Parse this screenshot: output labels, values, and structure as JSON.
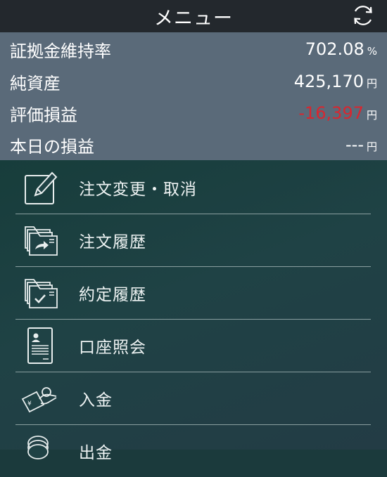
{
  "header": {
    "title": "メニュー"
  },
  "summary": {
    "margin_ratio": {
      "label": "証拠金維持率",
      "value": "702.08",
      "unit": "%"
    },
    "net_assets": {
      "label": "純資産",
      "value": "425,170",
      "unit": "円"
    },
    "valuation_pl": {
      "label": "評価損益",
      "value": "-16,397",
      "unit": "円"
    },
    "today_pl": {
      "label": "本日の損益",
      "value": "---",
      "unit": "円"
    }
  },
  "menu": {
    "items": [
      {
        "label": "注文変更・取消",
        "icon": "edit-icon"
      },
      {
        "label": "注文履歴",
        "icon": "folder-arrow-icon"
      },
      {
        "label": "約定履歴",
        "icon": "folder-check-icon"
      },
      {
        "label": "口座照会",
        "icon": "document-person-icon"
      },
      {
        "label": "入金",
        "icon": "deposit-icon"
      },
      {
        "label": "出金",
        "icon": "withdraw-icon"
      }
    ]
  },
  "colors": {
    "negative": "#d9262f",
    "summary_bg": "#5a6a79",
    "header_bg": "#23282d"
  }
}
